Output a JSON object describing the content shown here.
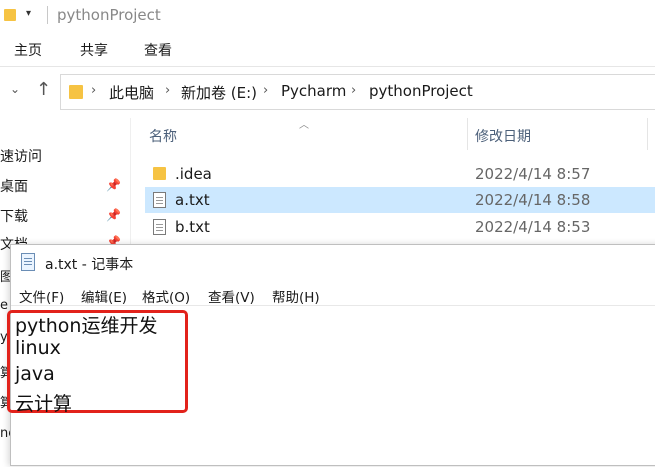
{
  "explorer": {
    "title": "pythonProject",
    "ribbon_tabs": [
      "主页",
      "共享",
      "查看"
    ],
    "breadcrumb": [
      "此电脑",
      "新加卷 (E:)",
      "Pycharm",
      "pythonProject"
    ],
    "nav_items": [
      {
        "label": "速访问",
        "pinned": false
      },
      {
        "label": "桌面",
        "pinned": true
      },
      {
        "label": "下载",
        "pinned": true
      },
      {
        "label": "文档",
        "pinned": true
      }
    ],
    "peek_items": [
      "图",
      "e",
      "y",
      "算",
      "算",
      "ne"
    ],
    "columns": {
      "name": "名称",
      "date": "修改日期"
    },
    "files": [
      {
        "name": ".idea",
        "date": "2022/4/14 8:57",
        "type": "folder",
        "selected": false
      },
      {
        "name": "a.txt",
        "date": "2022/4/14 8:58",
        "type": "text",
        "selected": true
      },
      {
        "name": "b.txt",
        "date": "2022/4/14 8:53",
        "type": "text",
        "selected": false
      }
    ],
    "colors": {
      "folder": "#f6c343",
      "selected_row": "#cce8ff"
    }
  },
  "notepad": {
    "title": "a.txt - 记事本",
    "menu": [
      "文件(F)",
      "编辑(E)",
      "格式(O)",
      "查看(V)",
      "帮助(H)"
    ],
    "lines": [
      "python运维开发",
      "linux",
      "java",
      "云计算"
    ],
    "highlight_color": "#e2221b"
  }
}
